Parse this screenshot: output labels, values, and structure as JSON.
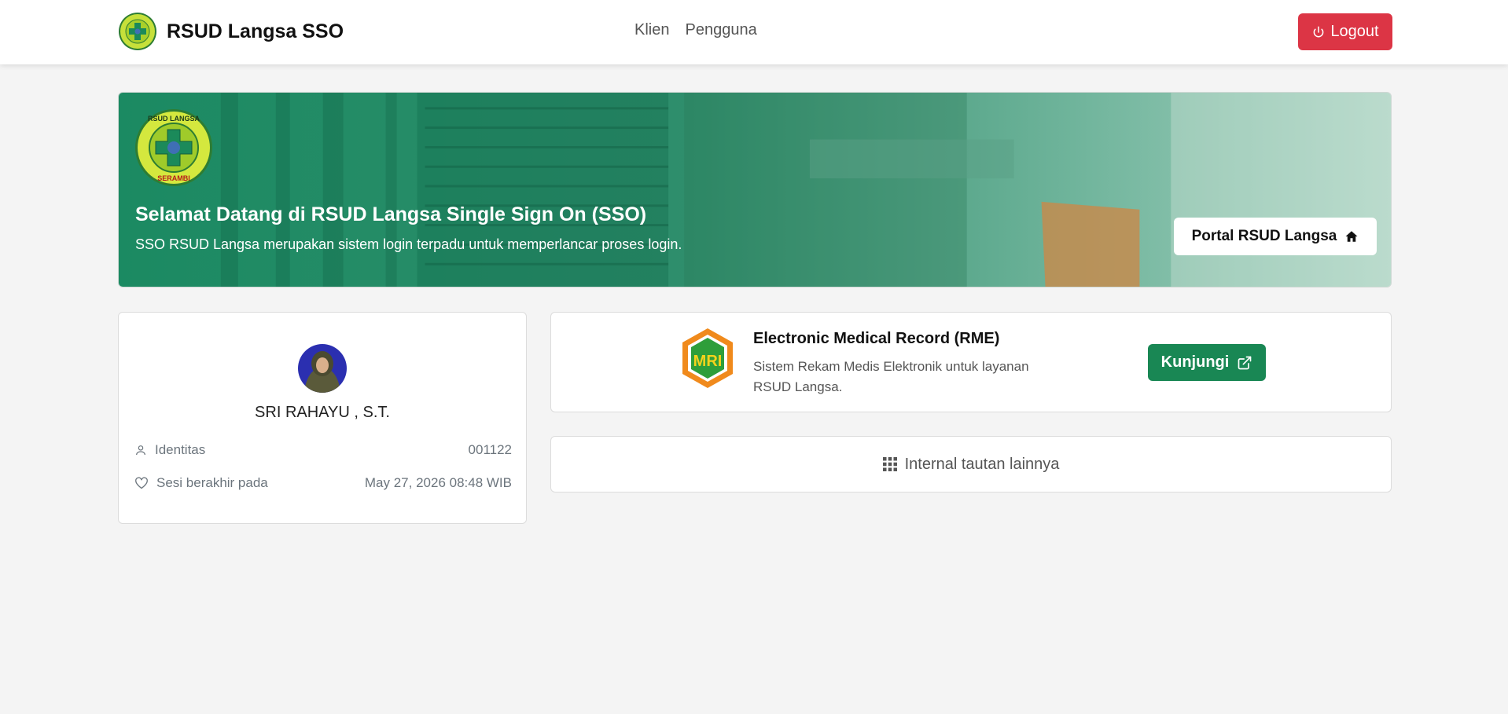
{
  "navbar": {
    "brand": "RSUD Langsa SSO",
    "links": [
      "Klien",
      "Pengguna"
    ],
    "logout_label": "Logout"
  },
  "banner": {
    "title": "Selamat Datang di RSUD Langsa Single Sign On (SSO)",
    "subtitle": "SSO RSUD Langsa merupakan sistem login terpadu untuk memperlancar proses login.",
    "portal_button": "Portal RSUD Langsa",
    "logo_text_top": "RSUD LANGSA",
    "logo_text_bottom": "SERAMBI"
  },
  "profile": {
    "name": "SRI RAHAYU , S.T.",
    "identity_label": "Identitas",
    "identity_value": "001122",
    "session_label": "Sesi berakhir pada",
    "session_value": "May 27, 2026 08:48 WIB"
  },
  "apps": [
    {
      "title": "Electronic Medical Record (RME)",
      "description": "Sistem Rekam Medis Elektronik untuk layanan RSUD Langsa.",
      "button": "Kunjungi",
      "logo_text": "MRI"
    }
  ],
  "internal_links_label": "Internal tautan lainnya",
  "colors": {
    "danger": "#dc3545",
    "success": "#198754",
    "banner_green": "#1f8a62"
  },
  "icons": {
    "logout": "power-icon",
    "portal": "home-icon",
    "identity": "user-icon",
    "session": "heart-icon",
    "visit": "external-link-icon",
    "links": "grid-icon"
  }
}
